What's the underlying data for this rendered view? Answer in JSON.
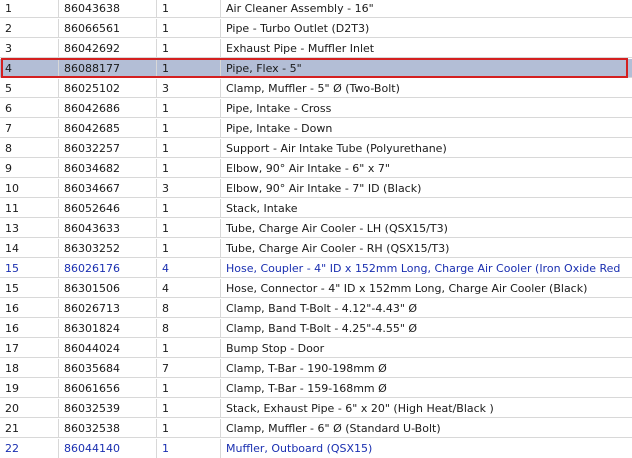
{
  "parts_table": {
    "rows": [
      {
        "item": "1",
        "part": "86043638",
        "qty": "1",
        "desc": "Air Cleaner Assembly - 16\""
      },
      {
        "item": "2",
        "part": "86066561",
        "qty": "1",
        "desc": "Pipe - Turbo Outlet (D2T3)"
      },
      {
        "item": "3",
        "part": "86042692",
        "qty": "1",
        "desc": "Exhaust Pipe - Muffler Inlet"
      },
      {
        "item": "4",
        "part": "86088177",
        "qty": "1",
        "desc": "Pipe, Flex - 5\""
      },
      {
        "item": "5",
        "part": "86025102",
        "qty": "3",
        "desc": "Clamp, Muffler - 5\" Ø (Two-Bolt)"
      },
      {
        "item": "6",
        "part": "86042686",
        "qty": "1",
        "desc": "Pipe, Intake - Cross"
      },
      {
        "item": "7",
        "part": "86042685",
        "qty": "1",
        "desc": "Pipe, Intake - Down"
      },
      {
        "item": "8",
        "part": "86032257",
        "qty": "1",
        "desc": "Support - Air Intake Tube (Polyurethane)"
      },
      {
        "item": "9",
        "part": "86034682",
        "qty": "1",
        "desc": "Elbow, 90° Air Intake - 6\" x 7\""
      },
      {
        "item": "10",
        "part": "86034667",
        "qty": "3",
        "desc": "Elbow, 90° Air Intake - 7\" ID (Black)"
      },
      {
        "item": "11",
        "part": "86052646",
        "qty": "1",
        "desc": "Stack, Intake"
      },
      {
        "item": "13",
        "part": "86043633",
        "qty": "1",
        "desc": "Tube, Charge Air Cooler - LH (QSX15/T3)"
      },
      {
        "item": "14",
        "part": "86303252",
        "qty": "1",
        "desc": "Tube, Charge Air Cooler - RH (QSX15/T3)"
      },
      {
        "item": "15",
        "part": "86026176",
        "qty": "4",
        "desc": "Hose, Coupler - 4\" ID x 152mm Long, Charge Air Cooler (Iron Oxide Red"
      },
      {
        "item": "15",
        "part": "86301506",
        "qty": "4",
        "desc": "Hose, Connector - 4\" ID x 152mm Long, Charge Air Cooler (Black)"
      },
      {
        "item": "16",
        "part": "86026713",
        "qty": "8",
        "desc": "Clamp, Band T-Bolt - 4.12\"-4.43\" Ø"
      },
      {
        "item": "16",
        "part": "86301824",
        "qty": "8",
        "desc": "Clamp, Band T-Bolt - 4.25\"-4.55\" Ø"
      },
      {
        "item": "17",
        "part": "86044024",
        "qty": "1",
        "desc": "Bump Stop - Door"
      },
      {
        "item": "18",
        "part": "86035684",
        "qty": "7",
        "desc": "Clamp, T-Bar - 190-198mm Ø"
      },
      {
        "item": "19",
        "part": "86061656",
        "qty": "1",
        "desc": "Clamp, T-Bar - 159-168mm Ø"
      },
      {
        "item": "20",
        "part": "86032539",
        "qty": "1",
        "desc": "Stack, Exhaust Pipe - 6\" x 20\" (High Heat/Black )"
      },
      {
        "item": "21",
        "part": "86032538",
        "qty": "1",
        "desc": "Clamp, Muffler - 6\" Ø (Standard U-Bolt)"
      },
      {
        "item": "22",
        "part": "86044140",
        "qty": "1",
        "desc": "Muffler, Outboard (QSX15)"
      }
    ]
  },
  "colors": {
    "selected_row_bg": "#b3bed6",
    "selection_border": "#d42020",
    "link_text": "#1a2fb0"
  }
}
